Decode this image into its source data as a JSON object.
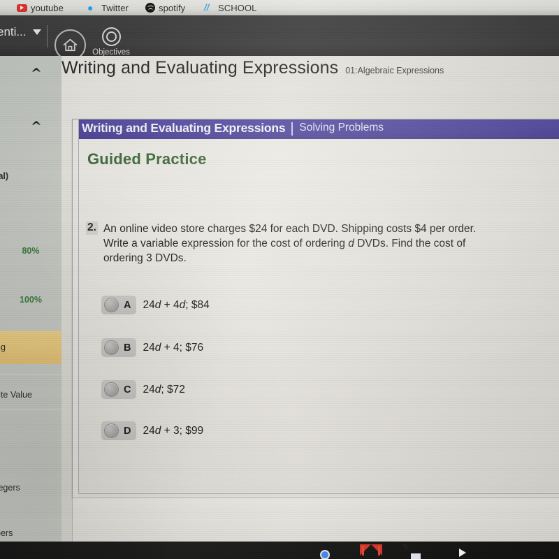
{
  "browser": {
    "bookmarks": [
      {
        "label": "youtube",
        "icon": "youtube-icon"
      },
      {
        "label": "Twitter",
        "icon": "twitter-icon"
      },
      {
        "label": "spotify",
        "icon": "spotify-icon"
      },
      {
        "label": "SCHOOL",
        "icon": "school-folder-icon"
      }
    ]
  },
  "app_toolbar": {
    "menu_label": "enti...",
    "menu_caret_icon": "chevron-down-icon",
    "home_icon": "home-icon",
    "objectives_icon": "bullseye-target-icon",
    "objectives_label": "Objectives"
  },
  "sidebar": {
    "collapse_icon": "chevron-up-icon",
    "items": [
      {
        "label": "ial)",
        "type": "text"
      },
      {
        "label": "80%",
        "type": "percent"
      },
      {
        "label": "100%",
        "type": "percent"
      },
      {
        "label": "ng",
        "type": "text",
        "highlighted": true
      },
      {
        "label": "ute Value",
        "type": "text"
      },
      {
        "label": "tegers",
        "type": "text"
      },
      {
        "label": "bers",
        "type": "text"
      }
    ]
  },
  "lesson": {
    "title": "Writing and Evaluating Expressions",
    "subtitle": "01:Algebraic Expressions"
  },
  "content": {
    "banner_title": "Writing and Evaluating Expressions",
    "banner_subtitle": "Solving Problems",
    "section_heading": "Guided Practice",
    "question": {
      "number": "2.",
      "line1": "An online video store charges $24 for each DVD. Shipping costs $4 per order.",
      "line2_a": "Write a variable expression for the cost of ordering ",
      "line2_var": "d",
      "line2_b": " DVDs. Find the cost of",
      "line3": "ordering 3 DVDs."
    },
    "choices": [
      {
        "letter": "A",
        "expr_a": "24",
        "var": "d",
        "expr_b": " + 4",
        "var2": "d",
        "expr_c": "; $84",
        "selected": false
      },
      {
        "letter": "B",
        "expr_a": "24",
        "var": "d",
        "expr_b": " + 4; $76",
        "var2": "",
        "expr_c": "",
        "selected": false
      },
      {
        "letter": "C",
        "expr_a": "24",
        "var": "d",
        "expr_b": "; $72",
        "var2": "",
        "expr_c": "",
        "selected": false
      },
      {
        "letter": "D",
        "expr_a": "24",
        "var": "d",
        "expr_b": " + 3; $99",
        "var2": "",
        "expr_c": "",
        "selected": false
      }
    ]
  },
  "dock": {
    "items": [
      {
        "name": "chrome-icon"
      },
      {
        "name": "gmail-icon"
      },
      {
        "name": "google-docs-icon"
      },
      {
        "name": "youtube-icon"
      }
    ]
  },
  "colors": {
    "banner_purple": "#4a4099",
    "heading_green": "#35622f",
    "highlight_yellow": "#e9c87a",
    "toolbar_dark": "#393939"
  }
}
